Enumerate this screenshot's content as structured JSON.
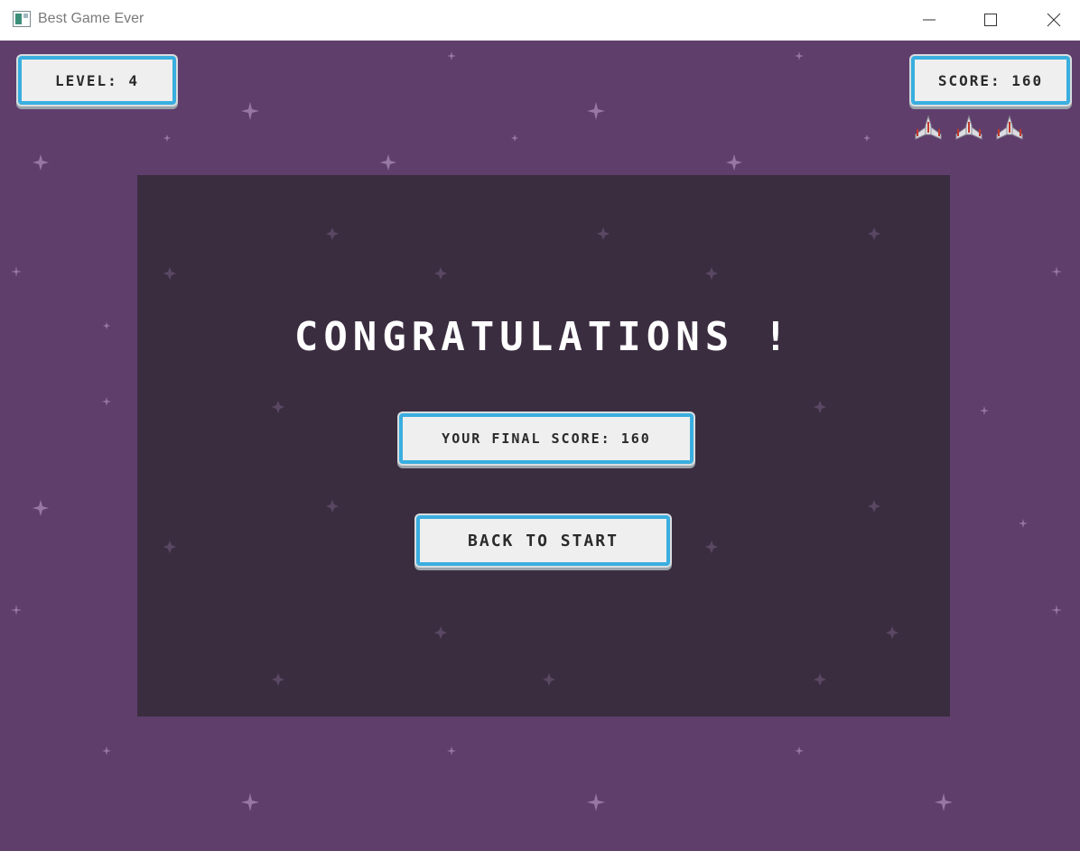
{
  "window": {
    "title": "Best Game Ever",
    "icon": "app-window-icon",
    "controls": [
      "minimize-icon",
      "maximize-icon",
      "close-icon"
    ]
  },
  "hud": {
    "level_label": "LEVEL: 4",
    "score_label": "SCORE: 160",
    "lives_icon": "spaceship-icon",
    "lives_count": 3
  },
  "dialog": {
    "title": "CONGRATULATIONS !",
    "final_score_label": "YOUR FINAL SCORE: 160",
    "back_button_label": "BACK TO START"
  },
  "colors": {
    "background": "#5f3e6c",
    "panel": "#3b2d40",
    "button_fill": "#efefef",
    "button_border": "#3aaedf",
    "ship_accent": "#c0392b"
  }
}
